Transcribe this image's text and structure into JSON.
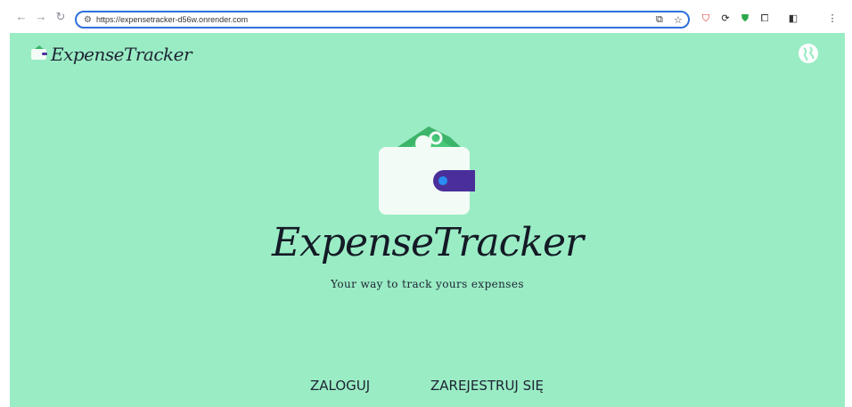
{
  "browser": {
    "url": "https://expensetracker-d56w.onrender.com",
    "back_icon": "back-arrow-icon",
    "forward_icon": "forward-arrow-icon",
    "reload_icon": "reload-icon"
  },
  "header": {
    "brand": "ExpenseTracker"
  },
  "hero": {
    "title": "ExpenseTracker",
    "tagline": "Your way to track yours expenses"
  },
  "auth": {
    "login_label": "ZALOGUJ",
    "register_label": "ZAREJESTRUJ SIĘ"
  },
  "colors": {
    "background": "#9aecc4",
    "wallet_body": "#f2fbf6",
    "wallet_clasp": "#4a2f9a",
    "clasp_dot": "#2a8cf0",
    "money": "#3cb46a"
  }
}
